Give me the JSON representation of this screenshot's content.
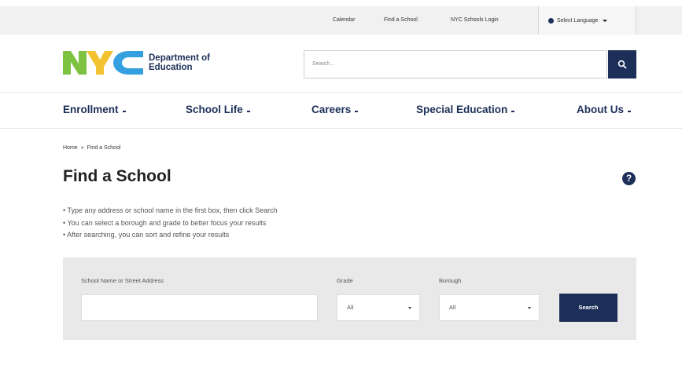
{
  "utility": {
    "calendar": "Calendar",
    "find_school": "Find a School",
    "login": "NYC Schools Login",
    "language": "Select Language"
  },
  "header": {
    "logo_text": "NYC",
    "department_line1": "Department of",
    "department_line2": "Education",
    "search_placeholder": "Search..."
  },
  "nav": {
    "items": [
      {
        "label": "Enrollment"
      },
      {
        "label": "School Life"
      },
      {
        "label": "Careers"
      },
      {
        "label": "Special Education"
      },
      {
        "label": "About Us"
      }
    ]
  },
  "breadcrumb": {
    "home": "Home",
    "separator": "»",
    "current": "Find a School"
  },
  "page": {
    "title": "Find a School",
    "help_label": "?",
    "instructions": [
      "Type any address or school name in the first box, then click Search",
      "You can select a borough and grade to better focus your results",
      "After searching, you can sort and refine your results"
    ]
  },
  "search_form": {
    "name_label": "School Name or Street Address",
    "name_value": "",
    "grade_label": "Grade",
    "grade_value": "All",
    "borough_label": "Borough",
    "borough_value": "All",
    "submit_label": "Search"
  },
  "colors": {
    "brand_navy": "#1c2f59",
    "logo_green": "#7ec242",
    "logo_blue": "#35a0e0"
  }
}
